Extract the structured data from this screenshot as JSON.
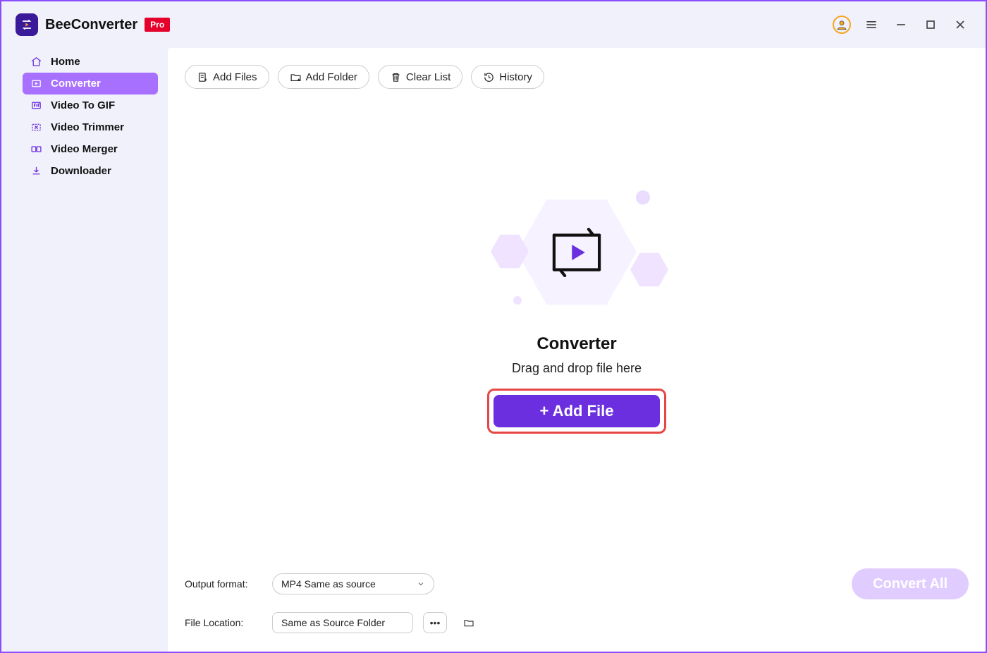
{
  "app": {
    "name": "BeeConverter",
    "badge": "Pro"
  },
  "sidebar": {
    "items": [
      {
        "id": "home",
        "label": "Home",
        "active": false
      },
      {
        "id": "converter",
        "label": "Converter",
        "active": true
      },
      {
        "id": "videotogif",
        "label": "Video To GIF",
        "active": false
      },
      {
        "id": "trimmer",
        "label": "Video Trimmer",
        "active": false
      },
      {
        "id": "merger",
        "label": "Video Merger",
        "active": false
      },
      {
        "id": "downloader",
        "label": "Downloader",
        "active": false
      }
    ]
  },
  "toolbar": {
    "add_files": "Add Files",
    "add_folder": "Add Folder",
    "clear_list": "Clear List",
    "history": "History"
  },
  "empty_state": {
    "title": "Converter",
    "subtitle": "Drag and drop file here",
    "add_file_label": "+ Add File"
  },
  "footer": {
    "output_format_label": "Output format:",
    "output_format_value": "MP4 Same as source",
    "file_location_label": "File Location:",
    "file_location_value": "Same as Source Folder",
    "convert_all_label": "Convert All"
  }
}
